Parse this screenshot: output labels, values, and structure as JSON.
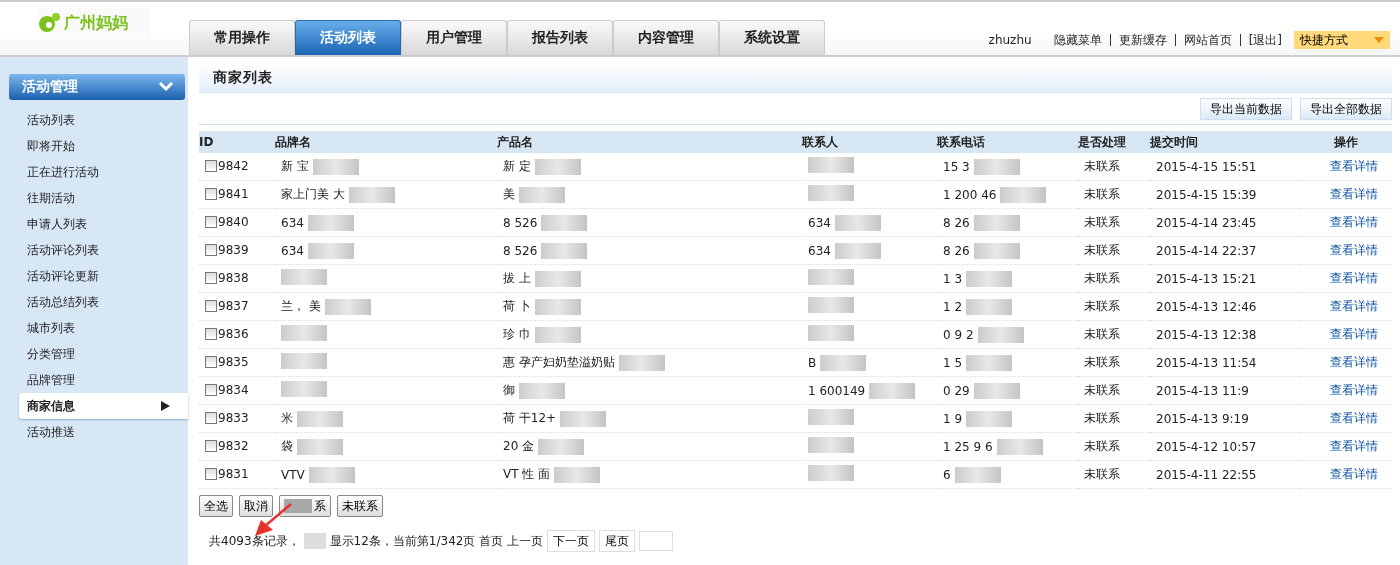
{
  "logo": {
    "text": "广州妈妈"
  },
  "nav_tabs": [
    {
      "label": "常用操作",
      "selected": false
    },
    {
      "label": "活动列表",
      "selected": true
    },
    {
      "label": "用户管理",
      "selected": false
    },
    {
      "label": "报告列表",
      "selected": false
    },
    {
      "label": "内容管理",
      "selected": false
    },
    {
      "label": "系统设置",
      "selected": false
    }
  ],
  "user": {
    "name": "zhuzhu",
    "links": [
      "隐藏菜单",
      "更新缓存",
      "网站首页",
      "[退出]"
    ],
    "shortcut": "快捷方式"
  },
  "sidebar": {
    "title": "活动管理",
    "expanded": true,
    "items": [
      {
        "label": "活动列表",
        "selected": false
      },
      {
        "label": "即将开始",
        "selected": false
      },
      {
        "label": "正在进行活动",
        "selected": false
      },
      {
        "label": "往期活动",
        "selected": false
      },
      {
        "label": "申请人列表",
        "selected": false
      },
      {
        "label": "活动评论列表",
        "selected": false
      },
      {
        "label": "活动评论更新",
        "selected": false
      },
      {
        "label": "活动总结列表",
        "selected": false
      },
      {
        "label": "城市列表",
        "selected": false
      },
      {
        "label": "分类管理",
        "selected": false
      },
      {
        "label": "品牌管理",
        "selected": false
      },
      {
        "label": "商家信息",
        "selected": true
      },
      {
        "label": "活动推送",
        "selected": false
      }
    ]
  },
  "page_title": "商家列表",
  "export_buttons": [
    "导出当前数据",
    "导出全部数据"
  ],
  "table": {
    "columns": [
      "ID",
      "品牌名",
      "产品名",
      "联系人",
      "联系电话",
      "是否处理",
      "提交时间",
      "操作"
    ],
    "rows": [
      {
        "checked": false,
        "id": "9842",
        "brand": {
          "text": "新 宝",
          "redacted": true
        },
        "product": {
          "text": "新 定",
          "redacted": true
        },
        "contact": {
          "redacted": true
        },
        "phone": {
          "text": "15 3",
          "redacted": true
        },
        "status": "未联系",
        "time": "2015-4-15 15:51",
        "action": "查看详情"
      },
      {
        "checked": false,
        "id": "9841",
        "brand": {
          "text": "家上门美 大",
          "redacted": true
        },
        "product": {
          "text": "美",
          "redacted": true
        },
        "contact": {
          "redacted": true
        },
        "phone": {
          "text": "1 200 46",
          "redacted": true
        },
        "status": "未联系",
        "time": "2015-4-15 15:39",
        "action": "查看详情"
      },
      {
        "checked": false,
        "id": "9840",
        "brand": {
          "text": "634",
          "redacted": true
        },
        "product": {
          "text": "8 526",
          "redacted": true
        },
        "contact": {
          "text": "634",
          "redacted": true
        },
        "phone": {
          "text": "8 26",
          "redacted": true
        },
        "status": "未联系",
        "time": "2015-4-14 23:45",
        "action": "查看详情"
      },
      {
        "checked": false,
        "id": "9839",
        "brand": {
          "text": "634",
          "redacted": true
        },
        "product": {
          "text": "8 526",
          "redacted": true
        },
        "contact": {
          "text": "634",
          "redacted": true
        },
        "phone": {
          "text": "8 26",
          "redacted": true
        },
        "status": "未联系",
        "time": "2015-4-14 22:37",
        "action": "查看详情"
      },
      {
        "checked": false,
        "id": "9838",
        "brand": {
          "redacted": true
        },
        "product": {
          "text": "拔 上",
          "redacted": true
        },
        "contact": {
          "redacted": true
        },
        "phone": {
          "text": "1 3",
          "redacted": true
        },
        "status": "未联系",
        "time": "2015-4-13 15:21",
        "action": "查看详情"
      },
      {
        "checked": false,
        "id": "9837",
        "brand": {
          "text": "兰， 美",
          "redacted": true
        },
        "product": {
          "text": "荷 卜",
          "redacted": true
        },
        "contact": {
          "redacted": true
        },
        "phone": {
          "text": "1 2",
          "redacted": true
        },
        "status": "未联系",
        "time": "2015-4-13 12:46",
        "action": "查看详情"
      },
      {
        "checked": false,
        "id": "9836",
        "brand": {
          "redacted": true
        },
        "product": {
          "text": "珍 巾",
          "redacted": true
        },
        "contact": {
          "redacted": true
        },
        "phone": {
          "text": "0 9 2",
          "redacted": true
        },
        "status": "未联系",
        "time": "2015-4-13 12:38",
        "action": "查看详情"
      },
      {
        "checked": false,
        "id": "9835",
        "brand": {
          "redacted": true
        },
        "product": {
          "text": "惠 孕产妇奶垫溢奶贴",
          "redacted": true
        },
        "contact": {
          "text": "B",
          "redacted": true
        },
        "phone": {
          "text": "1 5",
          "redacted": true
        },
        "status": "未联系",
        "time": "2015-4-13 11:54",
        "action": "查看详情"
      },
      {
        "checked": false,
        "id": "9834",
        "brand": {
          "redacted": true
        },
        "product": {
          "text": "御",
          "redacted": true
        },
        "contact": {
          "text": "1 600149",
          "redacted": true
        },
        "phone": {
          "text": "0 29",
          "redacted": true
        },
        "status": "未联系",
        "time": "2015-4-13 11:9",
        "action": "查看详情"
      },
      {
        "checked": false,
        "id": "9833",
        "brand": {
          "text": "米",
          "redacted": true
        },
        "product": {
          "text": "荷 干12+",
          "redacted": true
        },
        "contact": {
          "redacted": true
        },
        "phone": {
          "text": "1 9",
          "redacted": true
        },
        "status": "未联系",
        "time": "2015-4-13 9:19",
        "action": "查看详情"
      },
      {
        "checked": false,
        "id": "9832",
        "brand": {
          "text": "袋",
          "redacted": true
        },
        "product": {
          "text": "20 金",
          "redacted": true
        },
        "contact": {
          "redacted": true
        },
        "phone": {
          "text": "1 25 9 6",
          "redacted": true
        },
        "status": "未联系",
        "time": "2015-4-12 10:57",
        "action": "查看详情"
      },
      {
        "checked": false,
        "id": "9831",
        "brand": {
          "text": "VTV",
          "redacted": true
        },
        "product": {
          "text": "VT 性 面",
          "redacted": true
        },
        "contact": {
          "redacted": true
        },
        "phone": {
          "text": "6",
          "redacted": true
        },
        "status": "未联系",
        "time": "2015-4-11 22:55",
        "action": "查看详情"
      }
    ]
  },
  "bulk_buttons": [
    {
      "label": "全选",
      "redacted": false
    },
    {
      "label": "取消",
      "redacted": false
    },
    {
      "label": "系",
      "redacted": true
    },
    {
      "label": "未联系",
      "redacted": false
    }
  ],
  "pagination": {
    "total": "共4093条记录，",
    "summary": "显示12条，当前第1/342页",
    "links": [
      "首页",
      "上一页"
    ],
    "buttons": [
      "下一页",
      "尾页"
    ]
  },
  "annotation": {
    "kind": "arrow"
  }
}
